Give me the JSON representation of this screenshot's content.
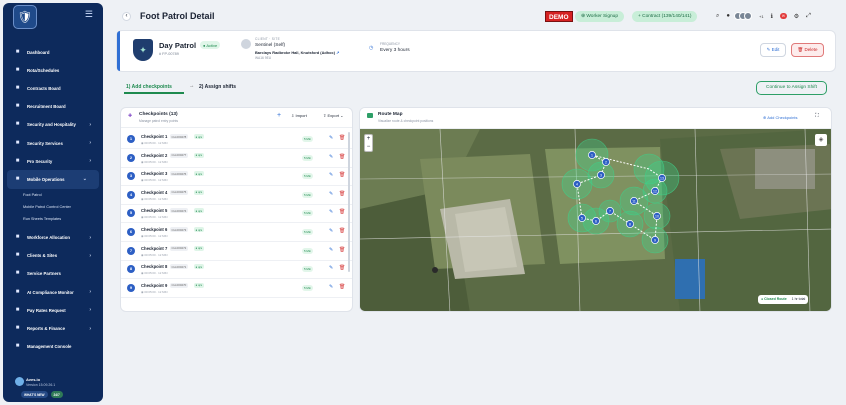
{
  "sidebar": {
    "items": [
      {
        "label": "Dashboard",
        "icon": "dashboard-icon",
        "chevron": false
      },
      {
        "label": "Rota/Schedules",
        "icon": "calendar-icon",
        "chevron": false
      },
      {
        "label": "Contracts Board",
        "icon": "contract-icon",
        "chevron": false
      },
      {
        "label": "Recruitment Board",
        "icon": "recruitment-icon",
        "chevron": false
      },
      {
        "label": "Security and Hospitality",
        "icon": "security-icon",
        "chevron": true
      },
      {
        "label": "Security Services",
        "icon": "services-icon",
        "chevron": true
      },
      {
        "label": "Pro Security",
        "icon": "pro-security-icon",
        "chevron": true
      },
      {
        "label": "Mobile Operations",
        "icon": "mobile-operations-icon",
        "chevron": true,
        "active": true
      }
    ],
    "subitems": [
      "Foot Patrol",
      "Mobile Patrol Control Center",
      "Run Sheets Templates"
    ],
    "items2": [
      {
        "label": "Workforce Allocation",
        "icon": "workforce-icon",
        "chevron": true
      },
      {
        "label": "Clients & Sites",
        "icon": "clients-icon",
        "chevron": true
      },
      {
        "label": "Service Partners",
        "icon": "partners-icon",
        "chevron": false
      },
      {
        "label": "AI Compliance Monitor",
        "icon": "compliance-icon",
        "chevron": true
      },
      {
        "label": "Pay Rates Request",
        "icon": "pay-icon",
        "chevron": true
      },
      {
        "label": "Reports & Finance",
        "icon": "reports-icon",
        "chevron": true
      },
      {
        "label": "Management Console",
        "icon": "console-icon",
        "chevron": false
      }
    ],
    "user": {
      "name": "Aves.io",
      "version": "Version 15.09.26.1"
    },
    "pills": [
      "WHAT'S NEW",
      "24/7"
    ]
  },
  "topbar": {
    "title": "Foot Patrol Detail",
    "demo": "DEMO",
    "worker_signup": "Worker Signup",
    "contract": "Contract (139/140/141)",
    "avatar_count": "+1"
  },
  "patrol": {
    "name": "Day Patrol",
    "status": "Active",
    "id": "# FP-00789",
    "client_label": "CLIENT · SITE",
    "client": "Sentinel (Self)",
    "site": "Barclays Radbroke Hall, Knutsford (Adhoc)",
    "postcode": "WA16 9EU",
    "freq_label": "FREQUENCY",
    "frequency": "Every 3 hours",
    "edit_label": "Edit",
    "delete_label": "Delete"
  },
  "steps": {
    "step1": "1) Add checkpoints",
    "step2": "2) Assign shifts",
    "continue": "Continue to Assign Shift"
  },
  "checkpoints": {
    "title": "Checkpoints (13)",
    "subtitle": "Manage patrol entry points",
    "import": "Import",
    "export": "Export",
    "rows": [
      {
        "num": "1",
        "name": "Checkpoint 1",
        "code": "CH-000278",
        "tag": "● qrs",
        "meta": "◉ 00:05:00 · 12 MIN",
        "dur": "5 Min"
      },
      {
        "num": "2",
        "name": "Checkpoint 2",
        "code": "CH-000277",
        "tag": "● qrs",
        "meta": "◉ 00:05:00 · 12 MIN",
        "dur": "5 Min"
      },
      {
        "num": "3",
        "name": "Checkpoint 3",
        "code": "CH-000276",
        "tag": "● qrs",
        "meta": "◉ 00:05:00 · 12 MIN",
        "dur": "5 Min"
      },
      {
        "num": "4",
        "name": "Checkpoint 4",
        "code": "CH-000275",
        "tag": "● qrs",
        "meta": "◉ 00:05:00 · 12 MIN",
        "dur": "5 Min"
      },
      {
        "num": "5",
        "name": "Checkpoint 5",
        "code": "CH-000274",
        "tag": "● qrs",
        "meta": "◉ 00:05:00 · 12 MIN",
        "dur": "5 Min"
      },
      {
        "num": "6",
        "name": "Checkpoint 6",
        "code": "CH-000273",
        "tag": "● qrs",
        "meta": "◉ 00:05:00 · 12 MIN",
        "dur": "5 Min"
      },
      {
        "num": "7",
        "name": "Checkpoint 7",
        "code": "CH-000272",
        "tag": "● qrs",
        "meta": "◉ 00:05:00 · 12 MIN",
        "dur": "5 Min"
      },
      {
        "num": "8",
        "name": "Checkpoint 8",
        "code": "CH-000271",
        "tag": "● qrs",
        "meta": "◉ 00:05:00 · 12 MIN",
        "dur": "5 Min"
      },
      {
        "num": "9",
        "name": "Checkpoint 9",
        "code": "CH-000270",
        "tag": "● qrs",
        "meta": "◉ 00:05:00 · 12 MIN",
        "dur": "5 Min"
      }
    ]
  },
  "map": {
    "title": "Route Map",
    "subtitle": "Visualize route & checkpoint positions",
    "add": "Add Checkpoints",
    "zoom_in": "+",
    "zoom_out": "−",
    "route_label": "Closed Route",
    "route_time": "1 hr total",
    "markers": [
      "1",
      "2",
      "3",
      "4",
      "5",
      "6",
      "7",
      "8",
      "9",
      "10",
      "11",
      "12",
      "13"
    ]
  },
  "colors": {
    "sidebar": "#0d2a5c",
    "accent": "#2e9f67",
    "primary": "#2f6fd4",
    "danger": "#d63a3a"
  }
}
